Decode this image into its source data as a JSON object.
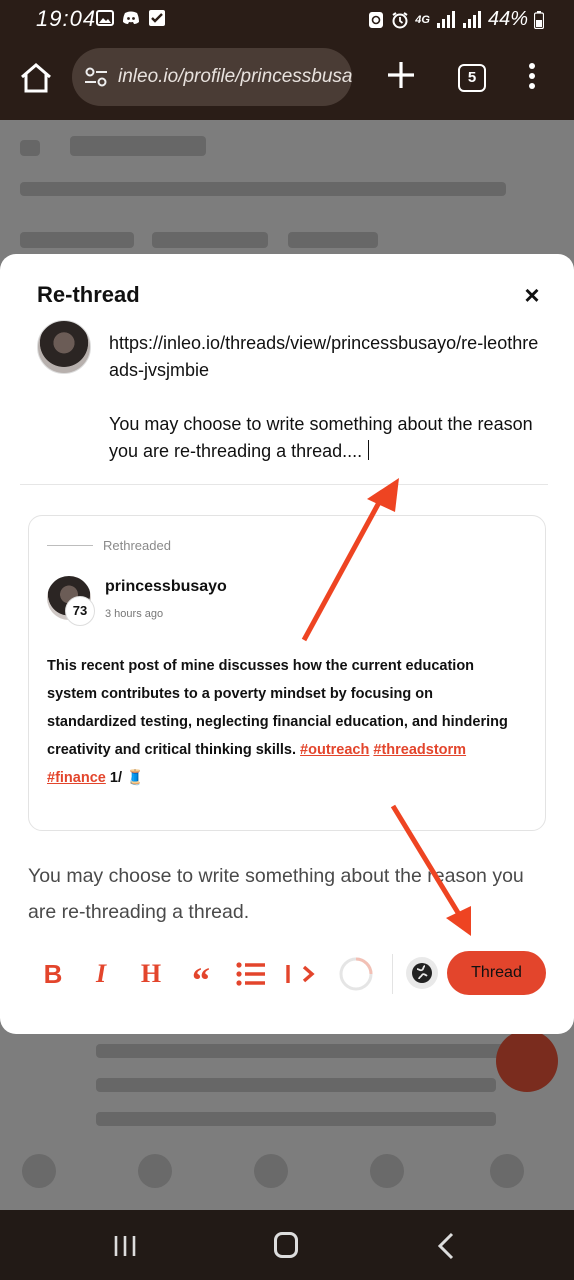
{
  "status_bar": {
    "time": "19:04",
    "network": "4G",
    "battery": "44%"
  },
  "browser": {
    "url": "inleo.io/profile/princessbusayo",
    "tab_count": "5"
  },
  "modal": {
    "title": "Re-thread",
    "close_label": "×",
    "compose_url": "https://inleo.io/threads/view/princessbusayo/re-leothreads-jvsjmbie",
    "compose_note": "You may choose to write something about the reason you are re-threading a thread....",
    "quote": {
      "label": "Rethreaded",
      "username": "princessbusayo",
      "reputation": "73",
      "time": "3 hours ago",
      "body": "This recent post of mine discusses how the current education system contributes to a poverty mindset by focusing on standardized testing, neglecting financial education, and hindering creativity and critical thinking skills.",
      "tags": [
        "#outreach",
        "#threadstorm",
        "#finance"
      ],
      "suffix": "1/ 🧵"
    },
    "placeholder_hint": "You may choose to write something about the reason you are re-threading a thread.",
    "toolbar": {
      "bold": "B",
      "italic": "I",
      "heading": "H",
      "quote": "“",
      "thread_button": "Thread"
    }
  },
  "icons": [
    "home-icon",
    "site-settings-icon",
    "new-tab-icon",
    "tabs-icon",
    "menu-icon",
    "globe-icon",
    "close-icon",
    "list-icon",
    "progress-ring-icon"
  ],
  "colors": {
    "accent": "#e3452c",
    "browser_chrome": "#2a1d17",
    "overlay": "#7d7d7d"
  }
}
